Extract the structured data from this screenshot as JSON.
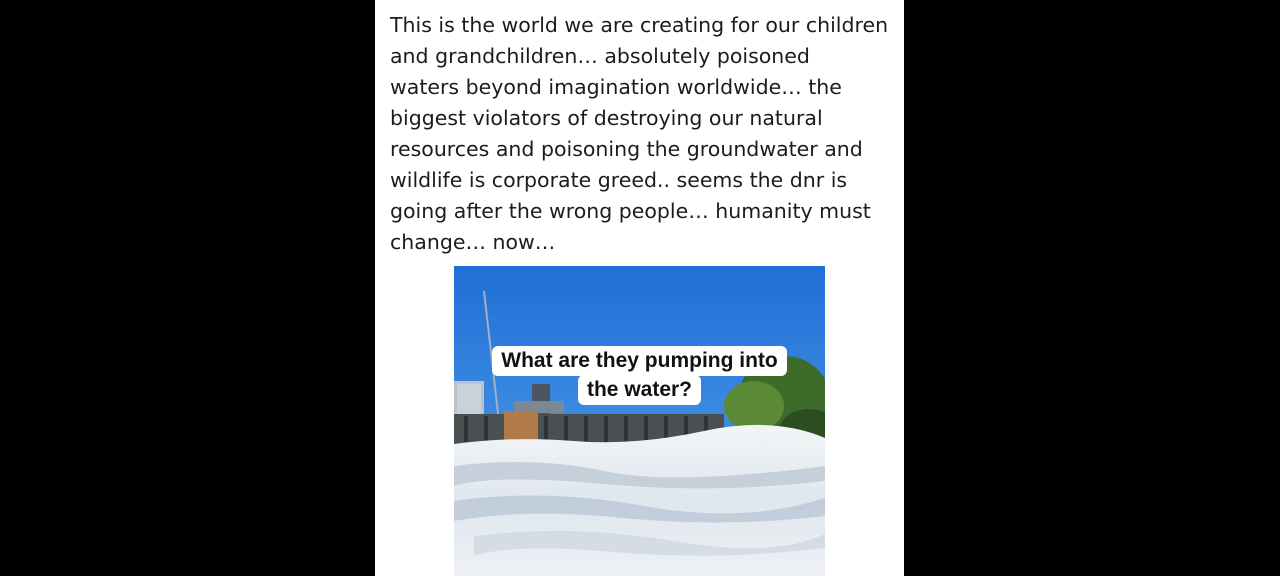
{
  "post": {
    "text_lines": [
      "This is the world we are creating for our children",
      "and grandchildren… absolutely poisoned",
      "waters beyond imagination worldwide… the",
      "biggest violators of destroying our natural",
      "resources and poisoning the groundwater and",
      "wildlife is corporate greed.. seems the dnr is",
      "going after the wrong people… humanity must",
      "change… now…"
    ]
  },
  "video": {
    "caption_lines": [
      "What are they pumping into",
      "the water?"
    ]
  },
  "colors": {
    "background": "#000000",
    "panel": "#ffffff",
    "text": "#1c1c1c",
    "sky": "#2a7fd8",
    "foam": "#e9eef3"
  }
}
